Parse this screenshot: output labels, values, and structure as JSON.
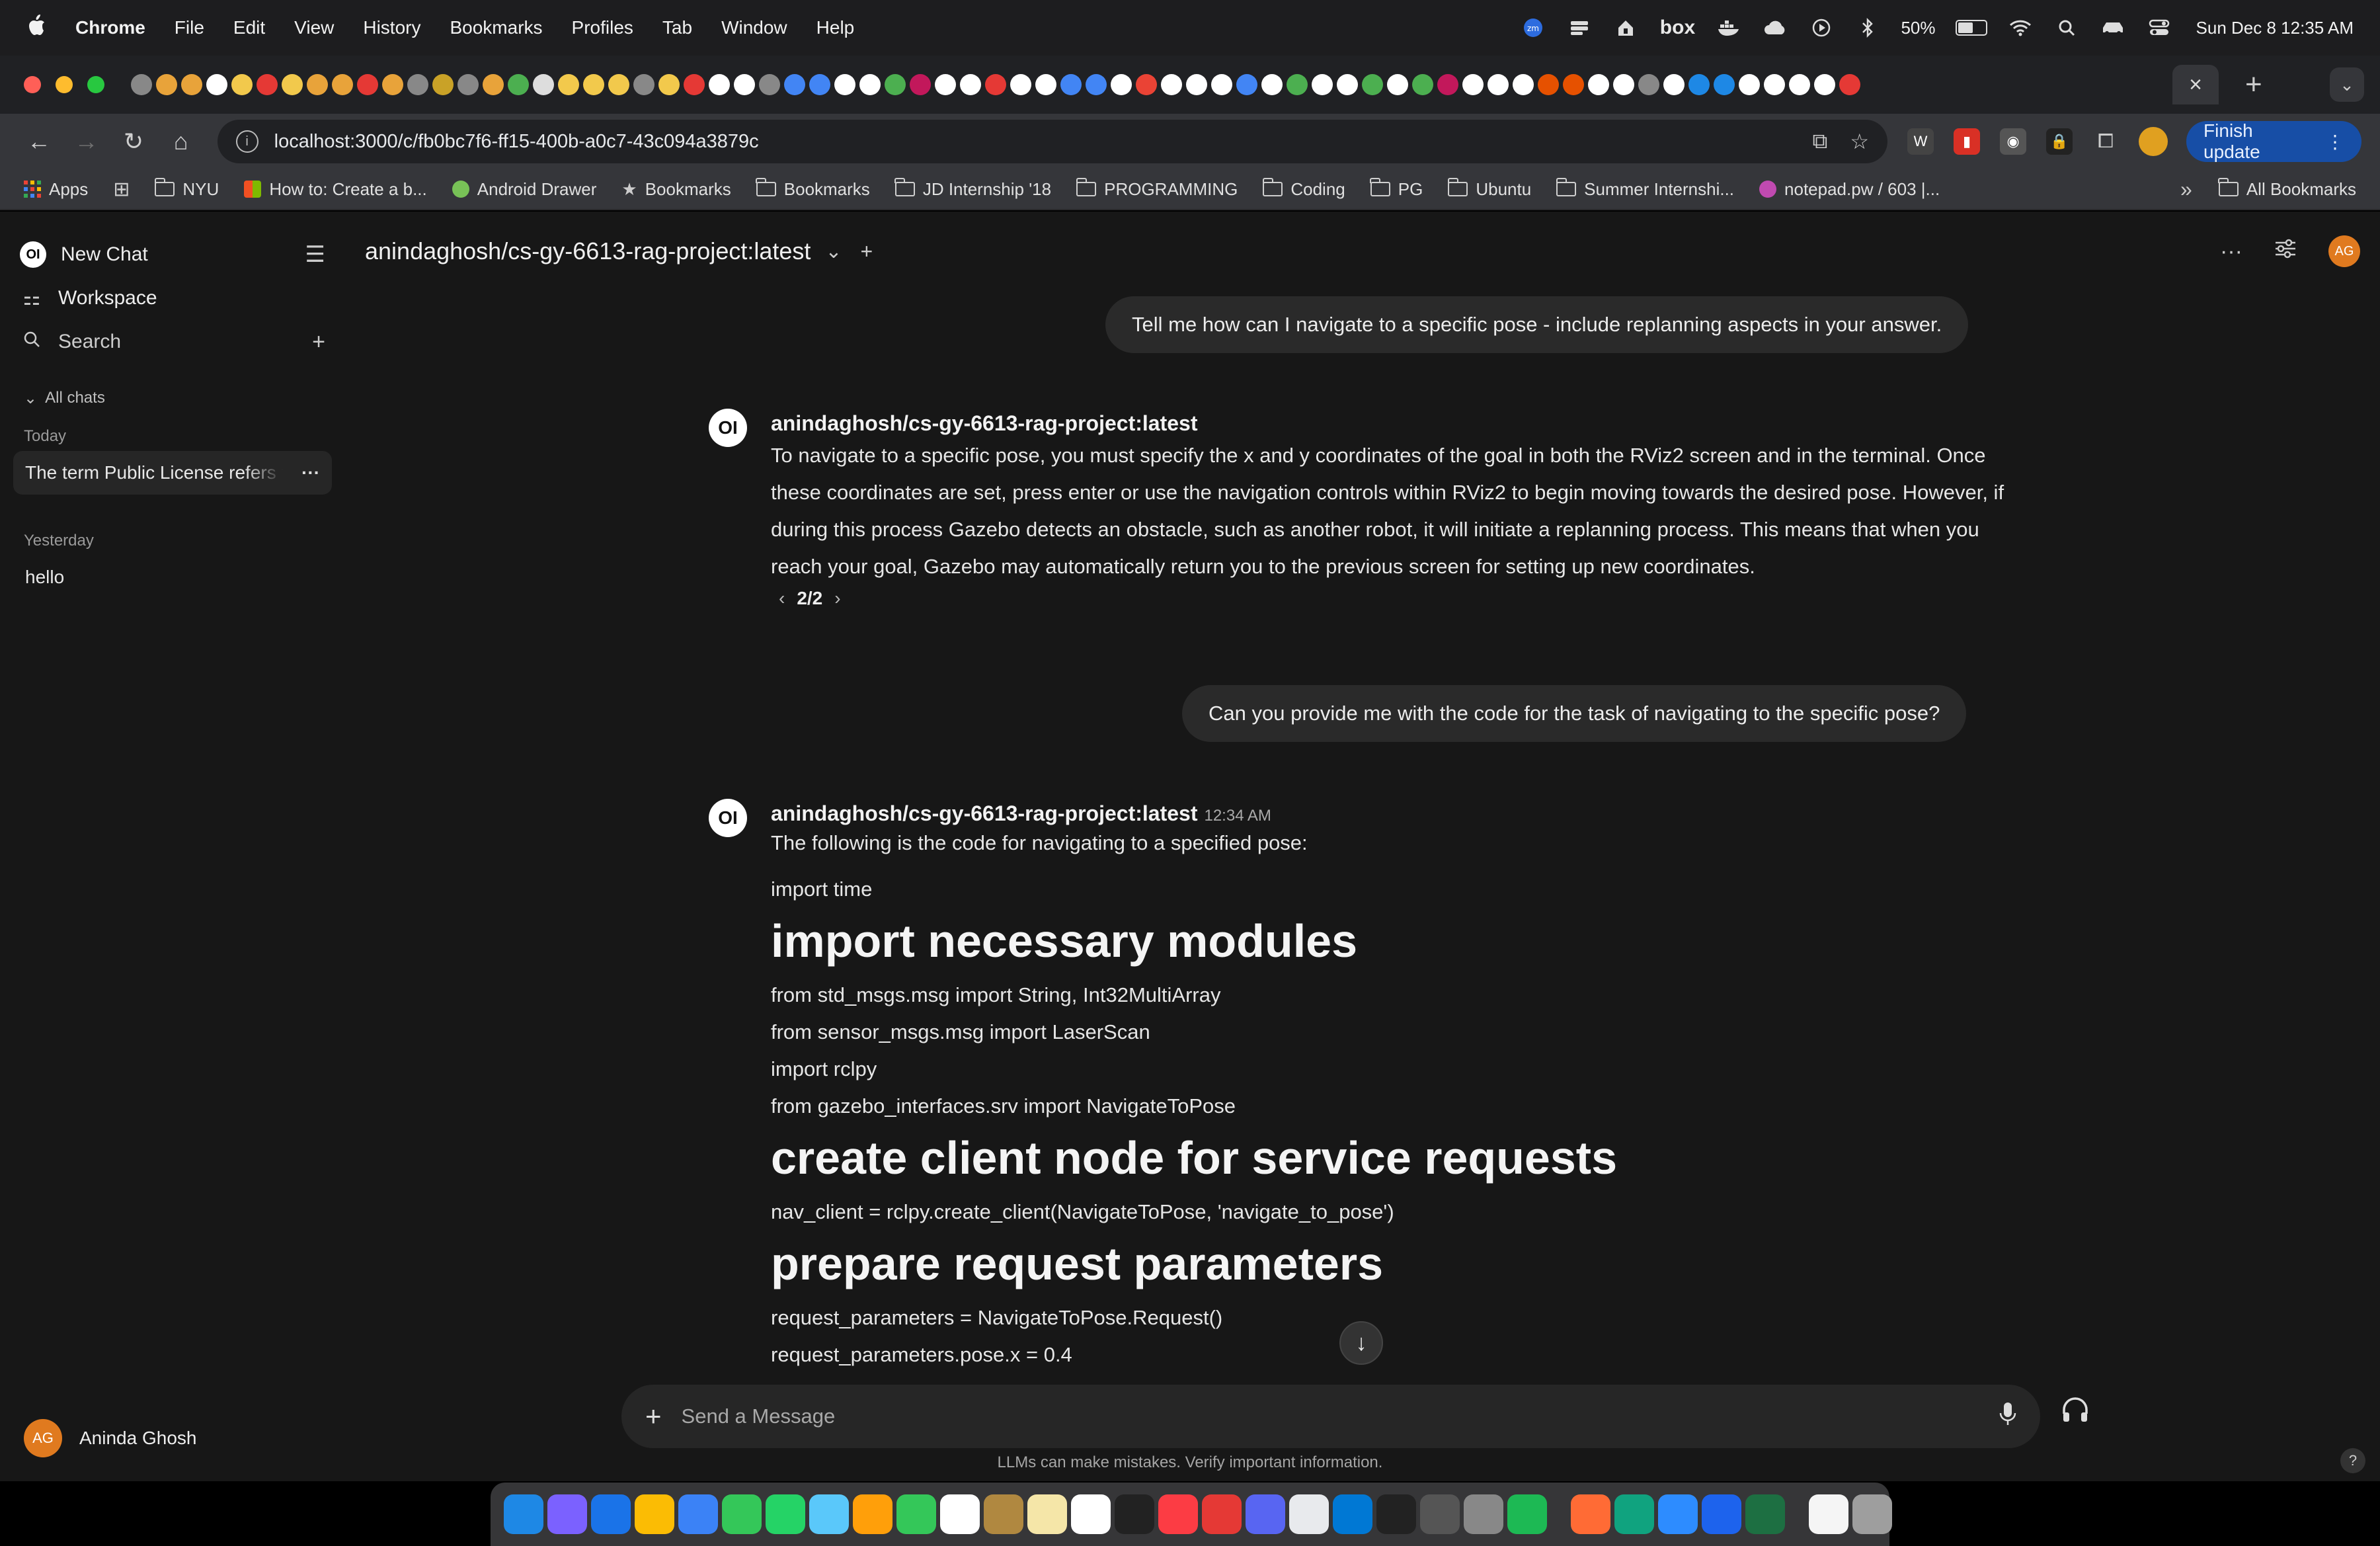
{
  "menubar": {
    "app": "Chrome",
    "items": [
      "File",
      "Edit",
      "View",
      "History",
      "Bookmarks",
      "Profiles",
      "Tab",
      "Window",
      "Help"
    ],
    "battery": "50%",
    "datetime": "Sun Dec 8  12:35 AM",
    "status_icons": [
      "zoom-icon",
      "stack-icon",
      "lock-house-icon",
      "box-app-icon",
      "docker-icon",
      "cloud-icon",
      "play-icon",
      "bluetooth-icon",
      "wifi-icon",
      "spotlight-icon",
      "car-icon",
      "control-center-icon"
    ],
    "box_label": "box"
  },
  "tabs": {
    "active_close": "×",
    "new_tab": "+"
  },
  "toolbar": {
    "url": "localhost:3000/c/fb0bc7f6-ff15-400b-a0c7-43c094a3879c",
    "finish_update": "Finish update"
  },
  "bookmarks": {
    "items": [
      {
        "label": "Apps",
        "icon": "apps-grid-icon"
      },
      {
        "label": "NYU",
        "icon": "folder-icon"
      },
      {
        "label": "How to: Create a b...",
        "icon": "microsoft-icon"
      },
      {
        "label": "Android Drawer",
        "icon": "android-icon"
      },
      {
        "label": "Bookmarks",
        "icon": "star-icon"
      },
      {
        "label": "Bookmarks",
        "icon": "folder-icon"
      },
      {
        "label": "JD Internship '18",
        "icon": "folder-icon"
      },
      {
        "label": "PROGRAMMING",
        "icon": "folder-icon"
      },
      {
        "label": "Coding",
        "icon": "folder-icon"
      },
      {
        "label": "PG",
        "icon": "folder-icon"
      },
      {
        "label": "Ubuntu",
        "icon": "folder-icon"
      },
      {
        "label": "Summer Internshi...",
        "icon": "folder-icon"
      },
      {
        "label": "notepad.pw / 603 |...",
        "icon": "notepad-icon"
      }
    ],
    "overflow": "»",
    "all_bookmarks": "All Bookmarks"
  },
  "sidebar": {
    "new_chat": "New Chat",
    "logo_text": "OI",
    "workspace": "Workspace",
    "search": "Search",
    "all_chats": "All chats",
    "groups": [
      {
        "date": "Today",
        "chats": [
          {
            "title": "The term Public License refers to",
            "active": true
          }
        ]
      },
      {
        "date": "Yesterday",
        "chats": [
          {
            "title": "hello",
            "active": false
          }
        ]
      }
    ],
    "user": {
      "initials": "AG",
      "name": "Aninda Ghosh"
    }
  },
  "chat": {
    "model": "anindaghosh/cs-gy-6613-rag-project:latest",
    "user_initials": "AG",
    "messages": [
      {
        "role": "user",
        "text": "Tell me how can I navigate to a specific pose - include replanning aspects in your answer."
      },
      {
        "role": "assistant",
        "name": "anindaghosh/cs-gy-6613-rag-project:latest",
        "text": "To navigate to a specific pose, you must specify the x and y coordinates of the goal in both the RViz2 screen and in the terminal. Once these coordinates are set, press enter or use the navigation controls within RViz2 to begin moving towards the desired pose. However, if during this process Gazebo detects an obstacle, such as another robot, it will initiate a replanning process. This means that when you reach your goal, Gazebo may automatically return you to the previous screen for setting up new coordinates.",
        "pager": "2/2"
      },
      {
        "role": "user",
        "text": "Can you provide me with the code for the task of navigating to the specific pose?"
      },
      {
        "role": "assistant",
        "name": "anindaghosh/cs-gy-6613-rag-project:latest",
        "time": "12:34 AM",
        "intro": "The following is the code for navigating to a specified pose:",
        "lines": [
          {
            "type": "p",
            "text": "import time"
          },
          {
            "type": "h1",
            "text": "import necessary modules"
          },
          {
            "type": "p",
            "text": "from std_msgs.msg import String, Int32MultiArray"
          },
          {
            "type": "p",
            "text": "from sensor_msgs.msg import LaserScan"
          },
          {
            "type": "p",
            "text": "import rclpy"
          },
          {
            "type": "p",
            "text": "from gazebo_interfaces.srv import NavigateToPose"
          },
          {
            "type": "h1",
            "text": "create client node for service requests"
          },
          {
            "type": "p",
            "text": "nav_client = rclpy.create_client(NavigateToPose, 'navigate_to_pose')"
          },
          {
            "type": "h1",
            "text": "prepare request parameters"
          },
          {
            "type": "p",
            "text": "request_parameters = NavigateToPose.Request()"
          },
          {
            "type": "p",
            "text": "request_parameters.pose.x = 0.4"
          }
        ]
      }
    ],
    "composer_placeholder": "Send a Message",
    "disclaimer": "LLMs can make mistakes. Verify important information.",
    "help": "?"
  },
  "colors": {
    "accent_avatar": "#e07a1f",
    "update_button": "#174ea6",
    "background": "#171717"
  }
}
